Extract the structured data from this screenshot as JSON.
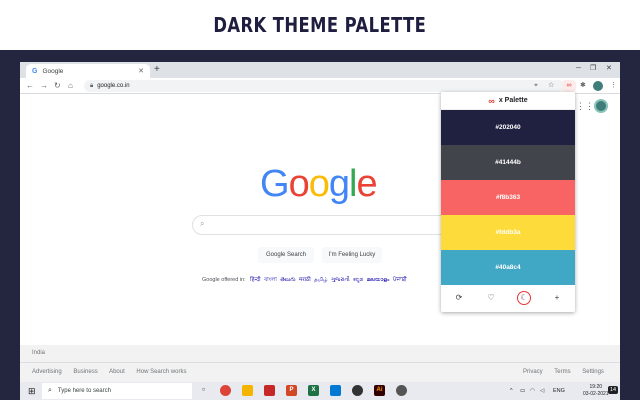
{
  "banner": {
    "title": "DARK THEME PALETTE"
  },
  "browser": {
    "tab_title": "Google",
    "tab_favicon": "G",
    "url": "google.co.in",
    "icons": {
      "back": "back-arrow-icon",
      "forward": "forward-arrow-icon",
      "reload": "reload-icon",
      "home": "home-icon",
      "lock": "lock-icon",
      "location": "location-icon",
      "star": "star-icon",
      "extension": "infinity-icon",
      "puzzle": "puzzle-icon",
      "menu": "kebab-menu-icon"
    }
  },
  "google": {
    "logo_letters": [
      {
        "char": "G",
        "color": "#4285f4"
      },
      {
        "char": "o",
        "color": "#ea4335"
      },
      {
        "char": "o",
        "color": "#fbbc05"
      },
      {
        "char": "g",
        "color": "#4285f4"
      },
      {
        "char": "l",
        "color": "#34a853"
      },
      {
        "char": "e",
        "color": "#ea4335"
      }
    ],
    "search_button": "Google Search",
    "lucky_button": "I'm Feeling Lucky",
    "offered_in_label": "Google offered in:",
    "languages": "हिन्दी বাংলা తెలుగు मराठी தமிழ் ગુજરાતી ಕನ್ನಡ മലയാളം ਪੰਜਾਬੀ"
  },
  "footer": {
    "country": "India",
    "left_links": [
      "Advertising",
      "Business",
      "About",
      "How Search works"
    ],
    "right_links": [
      "Privacy",
      "Terms",
      "Settings"
    ]
  },
  "popup": {
    "title": "x Palette",
    "swatches": [
      {
        "label": "#202040",
        "bg": "#202040",
        "fg": "#ffffff"
      },
      {
        "label": "#41444b",
        "bg": "#41444b",
        "fg": "#ffffff"
      },
      {
        "label": "#f8b363",
        "bg": "#f86363",
        "fg": "#ffffff"
      },
      {
        "label": "#fddb3a",
        "bg": "#fddb3a",
        "fg": "#ffffff"
      },
      {
        "label": "#40a8c4",
        "bg": "#40a8c4",
        "fg": "#ffffff"
      }
    ],
    "tools": [
      "refresh-icon",
      "heart-icon",
      "dark-mode-icon",
      "plus-icon"
    ],
    "active_tool": "dark-mode-icon"
  },
  "taskbar": {
    "search_placeholder": "Type here to search",
    "language": "ENG",
    "time": "19:20",
    "date": "03-02-2021",
    "notification_count": "14"
  }
}
